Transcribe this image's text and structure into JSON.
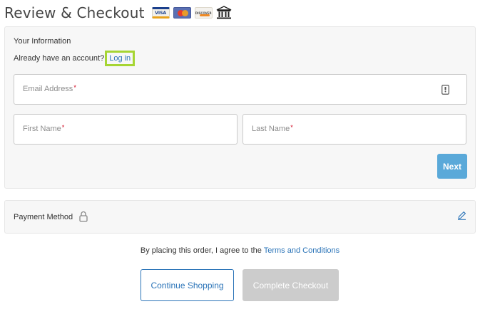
{
  "header": {
    "title": "Review & Checkout",
    "payment_icons": [
      "visa-icon",
      "mastercard-icon",
      "discover-icon",
      "bank-icon"
    ],
    "visa_text": "VISA",
    "discover_text": "DISCOVER"
  },
  "info": {
    "section_title": "Your Information",
    "account_prompt": "Already have an account?",
    "login_link": "Log in",
    "email_label": "Email Address",
    "first_name_label": "First Name",
    "last_name_label": "Last Name",
    "required_mark": "*",
    "next_button": "Next"
  },
  "payment": {
    "label": "Payment Method",
    "lock_icon": "lock-icon",
    "edit_icon": "pencil-icon"
  },
  "footer": {
    "agree_text": "By placing this order, I agree to the",
    "terms_link": "Terms and Conditions",
    "continue_button": "Continue Shopping",
    "complete_button": "Complete Checkout"
  },
  "colors": {
    "link_blue": "#2b74b8",
    "next_button_bg": "#5aa9d9",
    "highlight_green": "#a6d533",
    "required_red": "#d0021b",
    "disabled_gray": "#cccccc"
  }
}
